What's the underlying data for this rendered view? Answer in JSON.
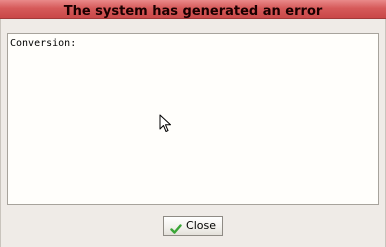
{
  "dialog": {
    "title": "The system has generated an error",
    "message_text": "Conversion:",
    "close_label": "Close",
    "icons": {
      "close": "check-icon",
      "pointer": "mouse-pointer-icon"
    }
  },
  "colors": {
    "title_bar": "#d65a5a",
    "background": "#efebe7",
    "text_area": "#fffefb",
    "check": "#3aa537"
  }
}
